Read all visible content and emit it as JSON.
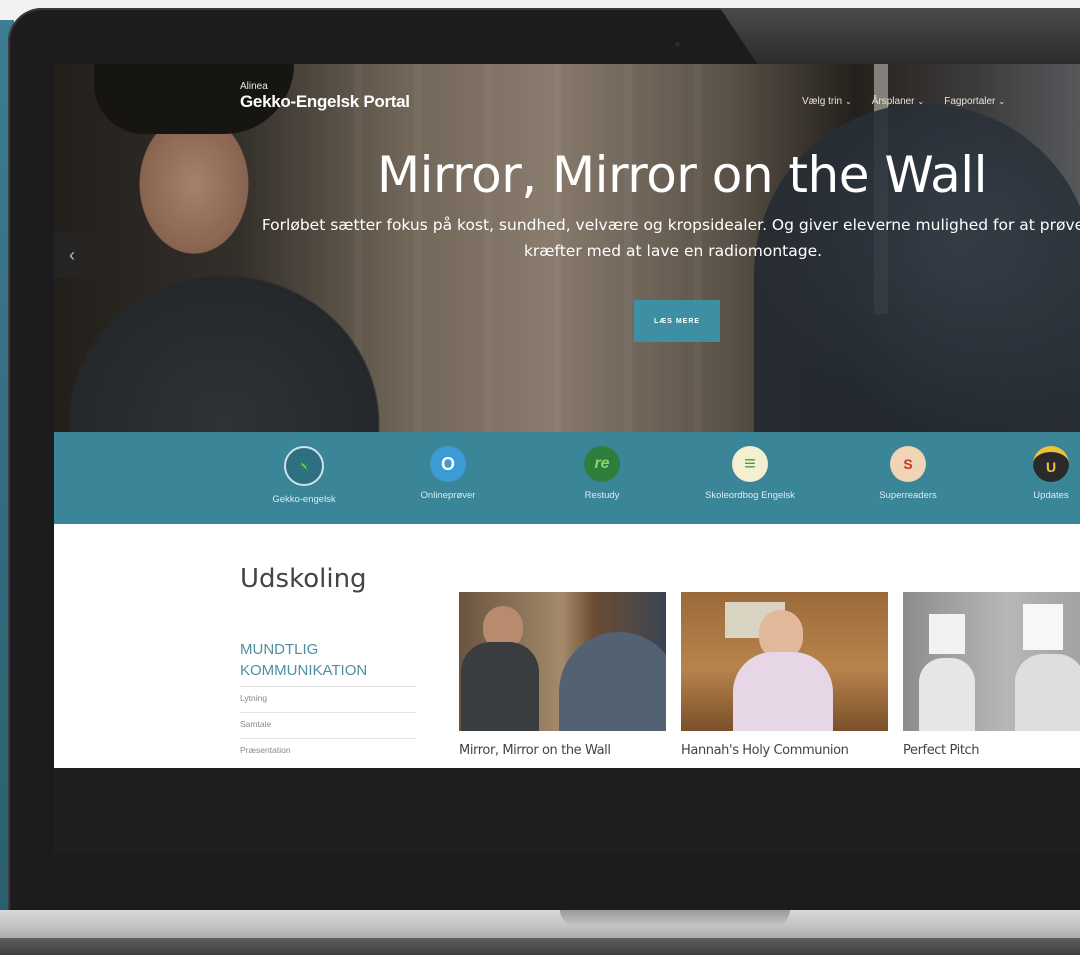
{
  "site": {
    "brand_small": "Alinea",
    "brand_title": "Gekko-Engelsk Portal"
  },
  "nav": {
    "items": [
      {
        "label": "Vælg trin"
      },
      {
        "label": "Årsplaner"
      },
      {
        "label": "Fagportaler"
      }
    ],
    "caret": "⌄"
  },
  "hero": {
    "title": "Mirror, Mirror on the Wall",
    "subtitle": "Forløbet sætter fokus på kost, sundhed, velvære og kropsidealer. Og giver eleverne mulighed for at prøve kræfter med at lave en radiomontage.",
    "button_label": "LÆS MERE",
    "prev_arrow": "‹"
  },
  "portals": [
    {
      "label": "Gekko-engelsk",
      "icon": "gekko-icon",
      "glyph": "🦎",
      "color": "#2e6f82"
    },
    {
      "label": "Onlineprøver",
      "icon": "onlineprover-icon",
      "glyph": "O",
      "color": "#3a9bd5"
    },
    {
      "label": "Restudy",
      "icon": "restudy-icon",
      "glyph": "re",
      "color": "#2f7d3c"
    },
    {
      "label": "Skoleordbog Engelsk",
      "icon": "dictionary-icon",
      "glyph": "≡",
      "color": "#9ccf6b"
    },
    {
      "label": "Superreaders",
      "icon": "superreaders-icon",
      "glyph": "S",
      "color": "#e9c9a4"
    },
    {
      "label": "Updates",
      "icon": "updates-icon",
      "glyph": "U",
      "color": "#2a2a2a"
    }
  ],
  "content": {
    "section_title": "Udskoling",
    "category_title": "MUNDTLIG KOMMUNIKATION",
    "category_items": [
      "Lytning",
      "Samtale",
      "Præsentation"
    ],
    "cards": [
      {
        "caption": "Mirror, Mirror on the Wall"
      },
      {
        "caption": "Hannah's Holy Communion"
      },
      {
        "caption": "Perfect Pitch"
      }
    ]
  }
}
